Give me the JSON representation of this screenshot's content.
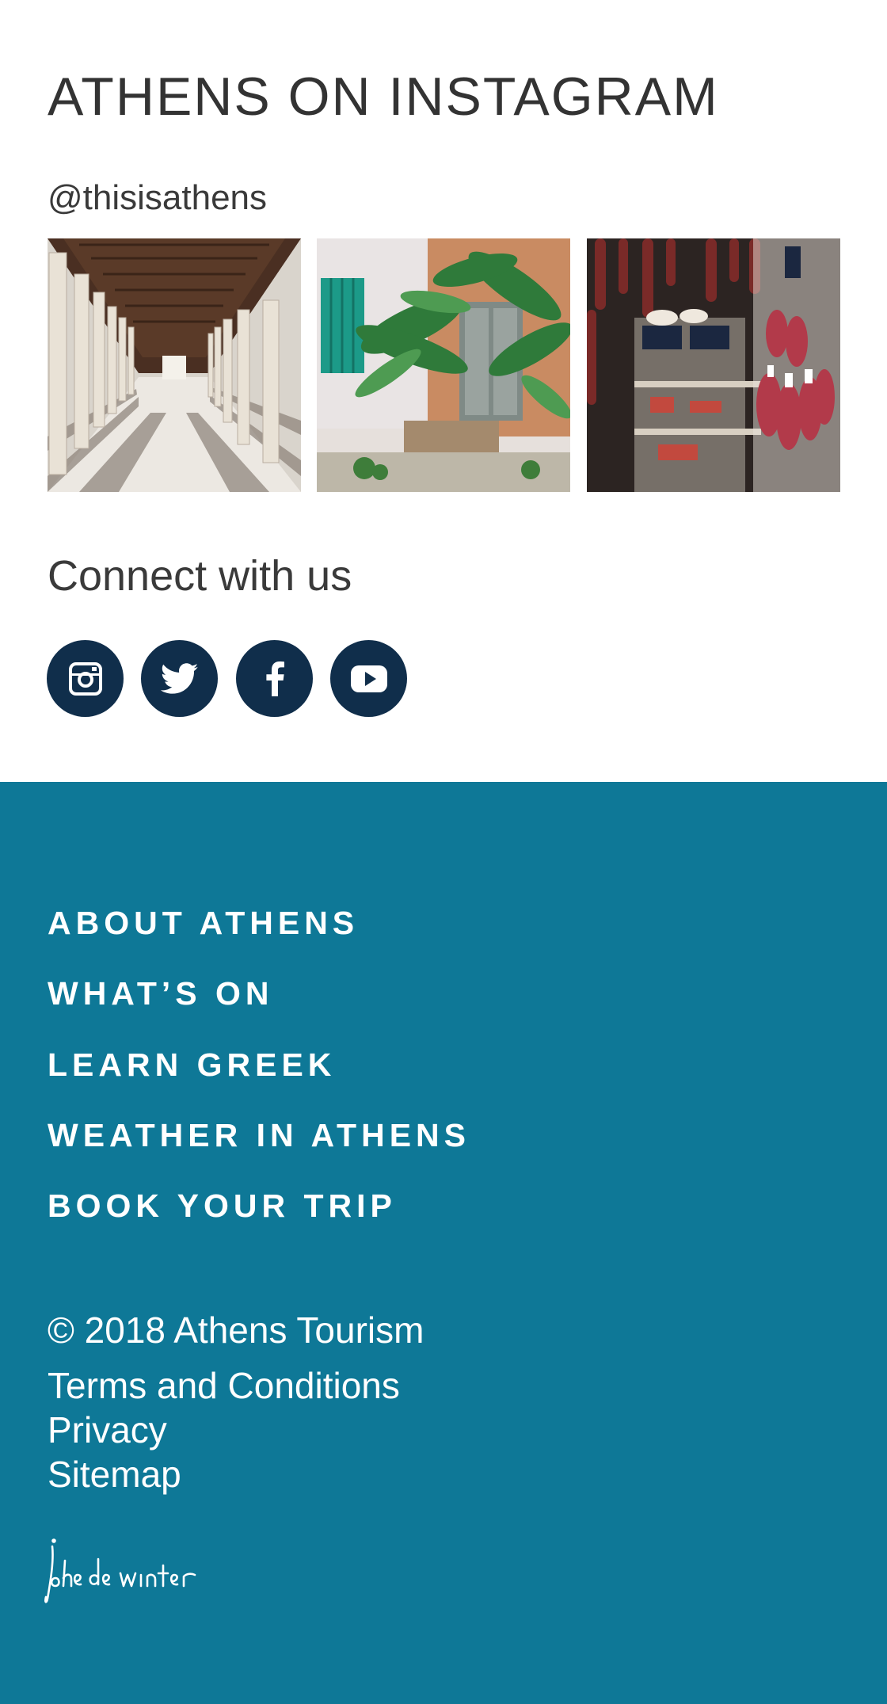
{
  "instagram": {
    "title": "ATHENS ON INSTAGRAM",
    "handle": "@thisisathens",
    "photos": [
      "colonnade-stoa-photo",
      "house-palm-photo",
      "deli-shop-photo"
    ]
  },
  "connect": {
    "label": "Connect with us",
    "icons": [
      "instagram-icon",
      "twitter-icon",
      "facebook-icon",
      "youtube-icon"
    ],
    "icon_bg": "#102e4b"
  },
  "footer": {
    "bg": "#0e7897",
    "nav": [
      "ABOUT ATHENS",
      "WHAT’S ON",
      "LEARN GREEK",
      "WEATHER IN ATHENS",
      "BOOK YOUR TRIP"
    ],
    "copyright": "© 2018 Athens Tourism",
    "links": [
      "Terms and Conditions",
      "Privacy",
      "Sitemap"
    ],
    "signature": "joke de winter"
  }
}
